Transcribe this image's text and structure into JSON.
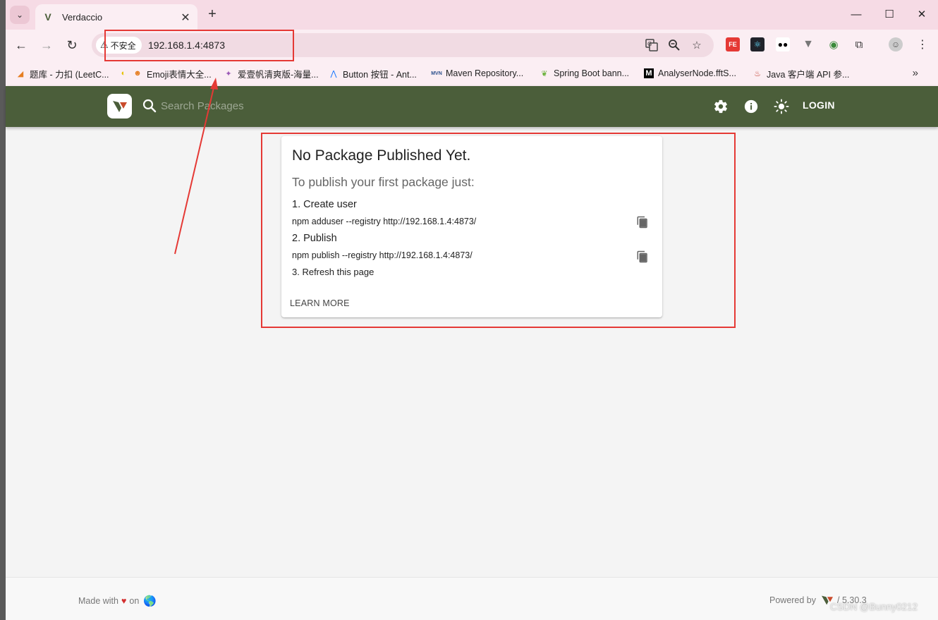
{
  "browser": {
    "tab": {
      "title": "Verdaccio"
    },
    "address": {
      "security_label": "不安全",
      "url": "192.168.1.4:4873"
    },
    "bookmarks": [
      "题库 - 力扣 (LeetC...",
      "Emoji表情大全...",
      "爱壹帆清爽版-海量...",
      "Button 按钮 - Ant...",
      "Maven Repository...",
      "Spring Boot bann...",
      "AnalyserNode.fftS...",
      "Java 客户端 API 参..."
    ]
  },
  "app": {
    "search_placeholder": "Search Packages",
    "login_label": "LOGIN",
    "accent": "#4b5e3a"
  },
  "card": {
    "title": "No Package Published Yet.",
    "subtitle": "To publish your first package just:",
    "step1": "1. Create user",
    "cmd1": "npm adduser --registry http://192.168.1.4:4873/",
    "step2": "2. Publish",
    "cmd2": "npm publish --registry http://192.168.1.4:4873/",
    "step3": "3. Refresh this page",
    "learn_more": "LEARN MORE"
  },
  "footer": {
    "made_with": "Made with",
    "heart": "♥",
    "on": "on",
    "powered_by": "Powered by",
    "version": "/ 5.30.3"
  },
  "watermark": "CSDN @Bunny0212"
}
